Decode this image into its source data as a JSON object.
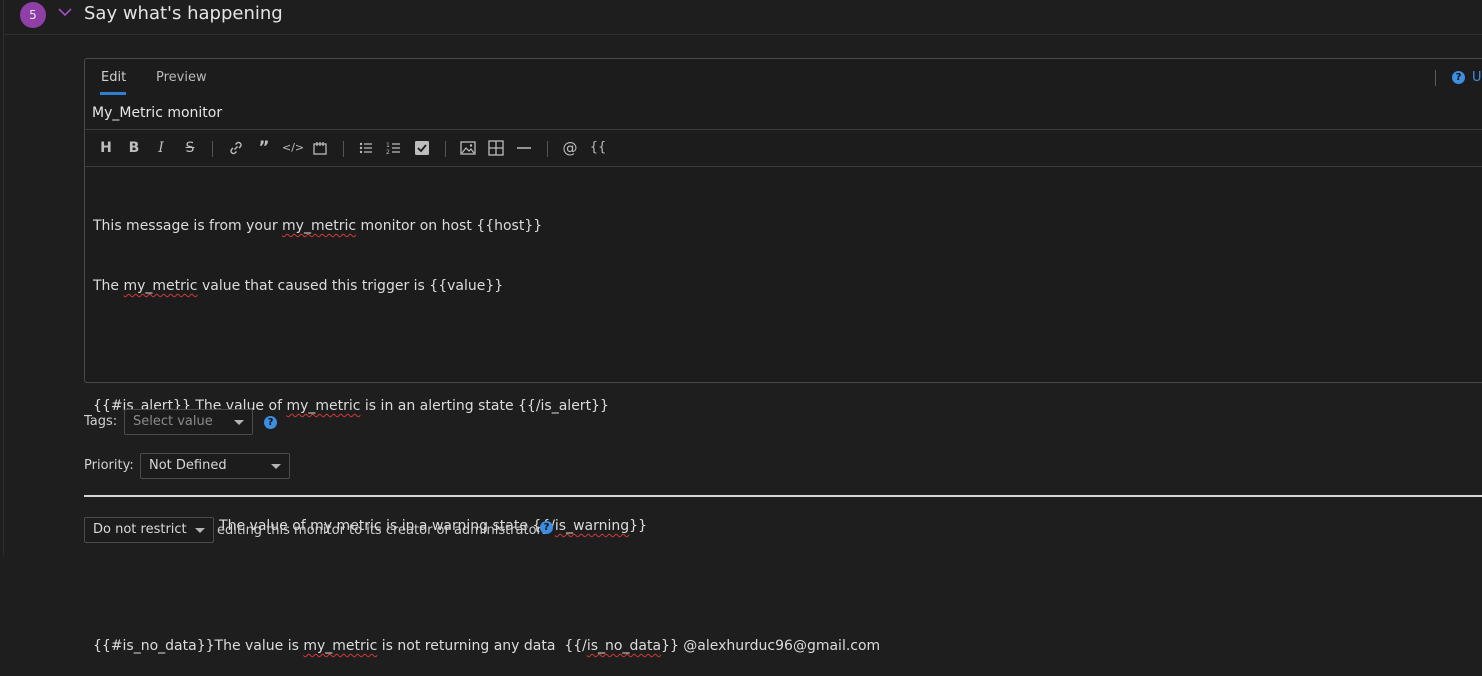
{
  "step": {
    "number": "5",
    "title": "Say what's happening"
  },
  "editor": {
    "tabs": [
      {
        "label": "Edit",
        "active": true
      },
      {
        "label": "Preview",
        "active": false
      }
    ],
    "help_label": "U",
    "title_value": "My_Metric monitor",
    "toolbar": [
      "heading-icon",
      "bold-icon",
      "italic-icon",
      "strikethrough-icon",
      "link-icon",
      "quote-icon",
      "code-icon",
      "code-block-icon",
      "bullet-list-icon",
      "numbered-list-icon",
      "checkbox-list-icon",
      "image-icon",
      "table-icon",
      "horizontal-rule-icon",
      "mention-icon",
      "template-variable-icon"
    ],
    "message_lines": [
      "This message is from your my_metric monitor on host {{host}}",
      "The my_metric value that caused this trigger is {{value}}",
      "",
      "{{#is_alert}} The value of my_metric is in an alerting state {{/is_alert}}",
      "",
      "{{#is_warning}} The value of my metric is in a warning state {{/is_warning}}",
      "",
      "{{#is_no_data}}The value is my_metric is not returning any data  {{/is_no_data}} @alexhurduc96@gmail.com"
    ]
  },
  "tags": {
    "label": "Tags:",
    "placeholder": "Select value"
  },
  "priority": {
    "label": "Priority:",
    "value": "Not Defined"
  },
  "restrict": {
    "value": "Do not restrict",
    "suffix": "editing this monitor to its creator or administrators"
  },
  "colors": {
    "accent": "#3d8ee3",
    "step_badge": "#8f3fa6",
    "background": "#1e1e1f",
    "squiggle": "#d23a3a"
  }
}
